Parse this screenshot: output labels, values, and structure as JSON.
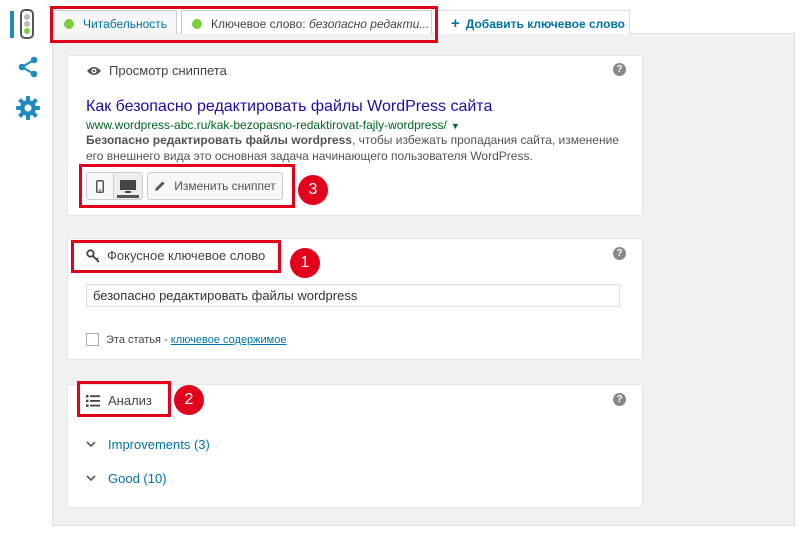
{
  "tabs": {
    "readability": "Читабельность",
    "keyword_prefix": "Ключевое слово: ",
    "keyword_value": "безопасно редакти...",
    "add_keyword": "Добавить ключевое слово",
    "add_icon": "+"
  },
  "snippet": {
    "title": "Просмотр сниппета",
    "preview_title": "Как безопасно редактировать файлы WordPress сайта",
    "preview_url": "www.wordpress-abc.ru/kak-bezopasno-redaktirovat-fajly-wordpress/",
    "preview_url_caret": "▼",
    "desc_bold": "Безопасно редактировать файлы wordpress",
    "desc_rest": ", чтобы избежать пропадания сайта, изменение его внешнего вида это основная задача начинающего пользователя WordPress.",
    "edit_button": "Изменить сниппет",
    "help": "?"
  },
  "focus": {
    "title": "Фокусное ключевое слово",
    "value": "безопасно редактировать файлы wordpress",
    "cornerstone_prefix": "Эта статья - ",
    "cornerstone_link": "ключевое содержимое",
    "help": "?"
  },
  "analysis": {
    "title": "Анализ",
    "results": [
      {
        "label": "Improvements (3)"
      },
      {
        "label": "Good (10)"
      }
    ],
    "help": "?"
  },
  "annotations": [
    "1",
    "2",
    "3"
  ],
  "colors": {
    "accent": "#0073aa",
    "good": "#7ad03a",
    "highlight": "#e3001b",
    "snippet_title": "#1a0dab",
    "snippet_url": "#006621"
  },
  "icons": {
    "traffic_light": "traffic-light-icon",
    "share": "share-icon",
    "settings": "gear-icon",
    "eye": "eye-icon",
    "key": "key-icon",
    "list": "list-icon",
    "mobile": "mobile-icon",
    "desktop": "desktop-icon",
    "pencil": "pencil-icon",
    "chevron": "chevron-down-icon"
  }
}
